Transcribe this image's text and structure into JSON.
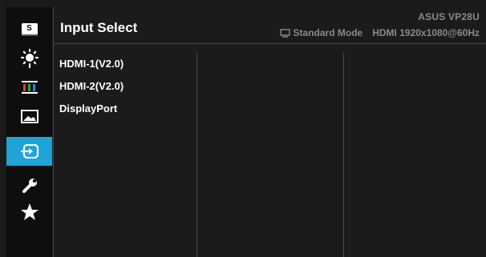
{
  "header": {
    "title": "Input Select",
    "model": "ASUS  VP28U",
    "mode": "Standard Mode",
    "signal": "HDMI 1920x1080@60Hz"
  },
  "sidebar": {
    "items": [
      {
        "icon": "splendid-icon",
        "label": "S"
      },
      {
        "icon": "brightness-icon"
      },
      {
        "icon": "color-icon"
      },
      {
        "icon": "image-icon"
      },
      {
        "icon": "input-select-icon",
        "active": true
      },
      {
        "icon": "system-setup-icon"
      },
      {
        "icon": "favorite-icon"
      }
    ]
  },
  "options": [
    "HDMI-1(V2.0)",
    "HDMI-2(V2.0)",
    "DisplayPort"
  ],
  "colors": {
    "background": "#1b1b1b",
    "sidebar": "#0e0e0e",
    "accent": "#1fa3d9",
    "text": "#ffffff",
    "muted": "#8a8a8a",
    "divider": "#4a4a4a"
  }
}
